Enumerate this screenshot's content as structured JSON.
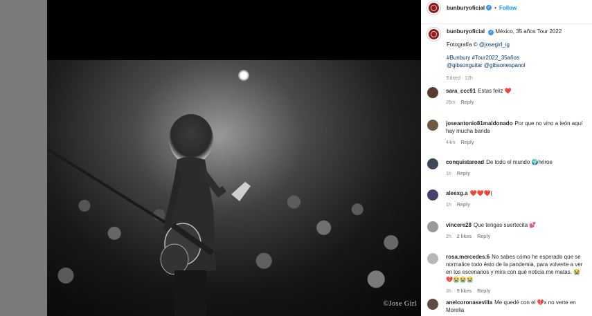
{
  "post": {
    "username": "bunburyoficial",
    "follow_label": "Follow",
    "separator": "•",
    "photo_credit": "©Jose Girl"
  },
  "caption": {
    "username": "bunburyoficial",
    "title": "México, 35 años Tour 2022",
    "photo_line_prefix": "Fotografía © ",
    "photo_handle": "@josegirl_ig",
    "hashtags": "#Bunbury #Tour2022_35años",
    "mentions": "@gibsonguitar @gibsonespanol",
    "edited": "Edited · 12h"
  },
  "comments": [
    {
      "user": "sara_ccc91",
      "text": "Estas feliz ❤️",
      "time": "26m",
      "likes": "",
      "reply": "Reply",
      "avatar_color": "#5a3b30"
    },
    {
      "user": "joseantonio81maldonado",
      "text": "Por que no vino a león aquí hay mucha banda",
      "time": "44m",
      "likes": "",
      "reply": "Reply",
      "avatar_color": "#6e5a3e"
    },
    {
      "user": "conquistaroad",
      "text": "De todo el mundo 🌍héroe",
      "time": "1h",
      "likes": "",
      "reply": "Reply",
      "avatar_color": "#3d4a5c"
    },
    {
      "user": "aleexg.a",
      "text": "❤️❤️❤️(",
      "time": "1h",
      "likes": "",
      "reply": "Reply",
      "avatar_color": "#4b3f6b"
    },
    {
      "user": "vincere28",
      "text": "Que tengas suertecita 💕",
      "time": "2h",
      "likes": "2 likes",
      "reply": "Reply",
      "avatar_color": "#9a9a9a"
    },
    {
      "user": "rosa.mercedes.6",
      "text": "No sabes cómo he esperado que se normalice todo ésto de la pandemia, para volverte a ver en los escenarios y mira con qué noticia me matas. 😭💔😭😭😭",
      "time": "3h",
      "likes": "5 likes",
      "reply": "Reply",
      "avatar_color": "#b7b7b7"
    },
    {
      "user": "anelcoronasevilla",
      "text": "Me quedé con el 💔x no verte en Morelia",
      "time": "",
      "likes": "",
      "reply": "",
      "avatar_color": "#5e4c44"
    }
  ],
  "icons": {
    "verified": "verified-badge-icon",
    "brand_avatar": "brand-logo-icon"
  },
  "colors": {
    "follow": "#0095f6",
    "link": "#00376b",
    "muted": "#8e8e8e",
    "text": "#262626"
  }
}
